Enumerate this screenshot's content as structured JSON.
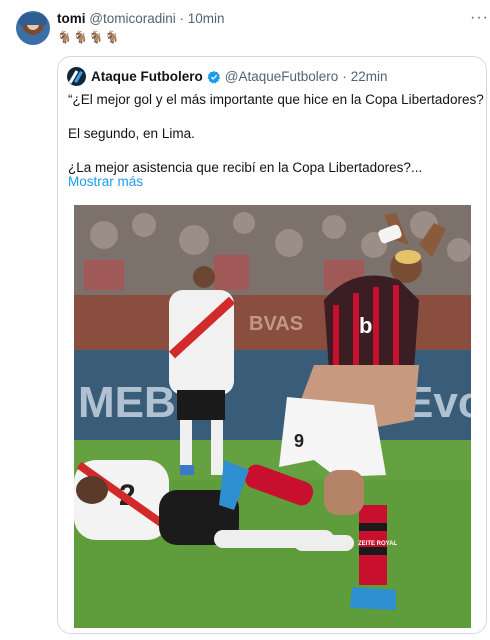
{
  "tweet": {
    "author_name": "tomi",
    "author_handle": "@tomicoradini",
    "separator": "·",
    "time": "10min",
    "more_label": "···",
    "emoji_line": "🐐🐐🐐🐐"
  },
  "quoted": {
    "author_name": "Ataque Futbolero",
    "author_handle": "@AtaqueFutbolero",
    "separator": "·",
    "time": "22min",
    "lines": [
      "“¿El mejor gol y el más importante que hice en la Copa Libertadores?",
      "El segundo, en Lima.",
      "¿La mejor asistencia que recibí en la Copa Libertadores?..."
    ],
    "show_more": "Mostrar más",
    "photo": {
      "jersey_number": "9",
      "shirt_text": "b",
      "shorts_text": "ZEITE ROYAL",
      "board_left": "MEBO",
      "board_right": "Evo",
      "board_mid": "BVAS",
      "opponent_number": "2"
    }
  },
  "colors": {
    "link": "#1d9bf0",
    "muted": "#536471",
    "border": "#cfd9de",
    "verified": "#1d9bf0"
  }
}
